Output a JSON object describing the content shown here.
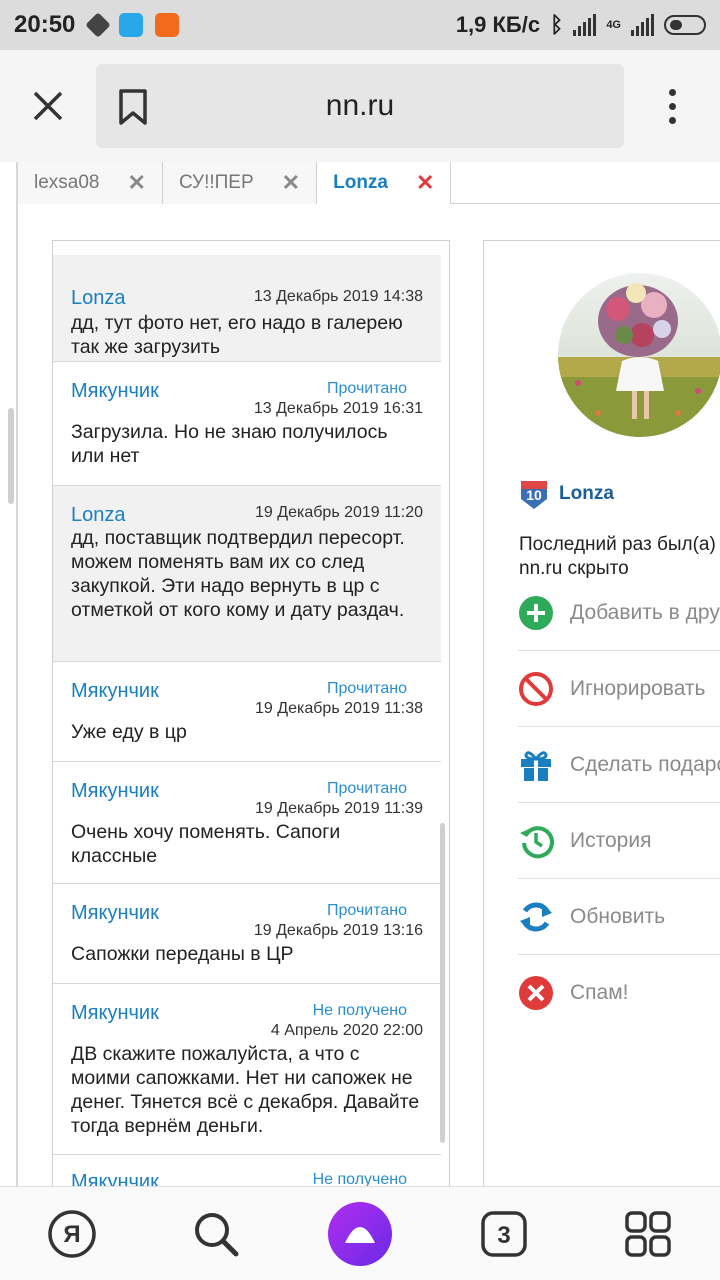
{
  "status_bar": {
    "time": "20:50",
    "network_speed": "1,9 КБ/с",
    "network_type": "4G"
  },
  "browser": {
    "url": "nn.ru"
  },
  "tabs": [
    {
      "label": "lexsa08"
    },
    {
      "label": "СУ!!ПЕР"
    },
    {
      "label": "Lonza"
    }
  ],
  "messages": [
    {
      "author": "Lonza",
      "status": "",
      "date": "13 Декабрь 2019 14:38",
      "text": "дд, тут фото нет, его надо в галерею так же загрузить"
    },
    {
      "author": "Мякунчик",
      "status": "Прочитано",
      "date": "13 Декабрь 2019 16:31",
      "text": "Загрузила. Но не знаю получилось или нет"
    },
    {
      "author": "Lonza",
      "status": "",
      "date": "19 Декабрь 2019 11:20",
      "text": "дд, поставщик подтвердил пересорт. можем поменять вам их со след закупкой. Эти надо вернуть в цр с отметкой от кого кому и дату раздач."
    },
    {
      "author": "Мякунчик",
      "status": "Прочитано",
      "date": "19 Декабрь 2019 11:38",
      "text": "Уже еду в цр"
    },
    {
      "author": "Мякунчик",
      "status": "Прочитано",
      "date": "19 Декабрь 2019 11:39",
      "text": "Очень хочу поменять. Сапоги классные"
    },
    {
      "author": "Мякунчик",
      "status": "Прочитано",
      "date": "19 Декабрь 2019 13:16",
      "text": "Сапожки переданы в ЦР"
    },
    {
      "author": "Мякунчик",
      "status": "Не получено",
      "date": "4 Апрель 2020 22:00",
      "text": "ДВ скажите пожалуйста, а что с моими сапожками. Нет ни сапожек не денег. Тянется всё с декабря. Давайте тогда вернём деньги."
    },
    {
      "author": "Мякунчик",
      "status": "Не получено",
      "date": "",
      "text": ""
    }
  ],
  "profile": {
    "level": "10",
    "name": "Lonza",
    "last_seen_line1": "Последний раз был(а) на",
    "last_seen_line2": "nn.ru скрыто",
    "actions": [
      {
        "label": "Добавить в друзья",
        "icon": "add-friend-icon",
        "color": "#2eaa5a"
      },
      {
        "label": "Игнорировать",
        "icon": "ignore-icon",
        "color": "#e03b3b"
      },
      {
        "label": "Сделать подарок",
        "icon": "gift-icon",
        "color": "#1a7fc1"
      },
      {
        "label": "История",
        "icon": "history-icon",
        "color": "#2eaa5a"
      },
      {
        "label": "Обновить",
        "icon": "refresh-icon",
        "color": "#1a7fc1"
      },
      {
        "label": "Спам!",
        "icon": "spam-icon",
        "color": "#e03b3b"
      }
    ]
  },
  "bottom_nav": {
    "yandex": "Я",
    "tabs_count": "3"
  }
}
